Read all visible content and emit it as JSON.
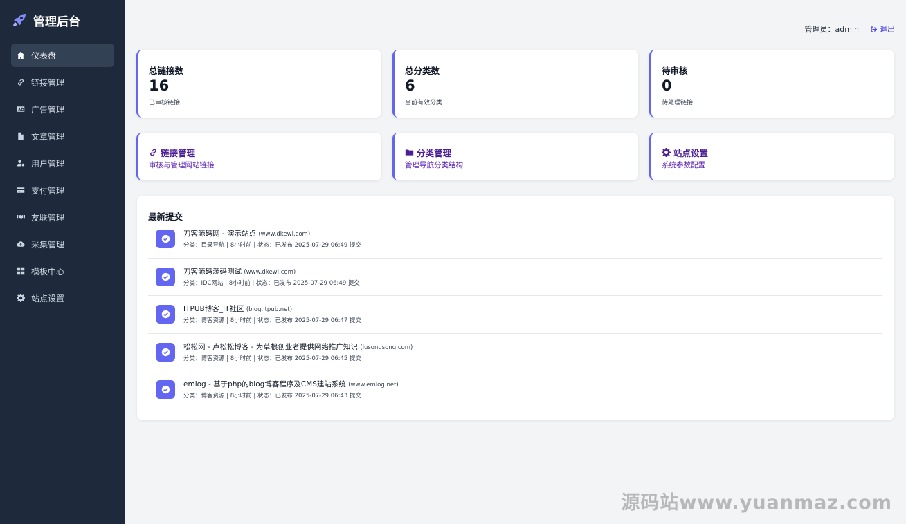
{
  "brand": {
    "title": "管理后台",
    "icon": "rocket-icon"
  },
  "sidebar": {
    "items": [
      {
        "label": "仪表盘",
        "icon": "home-icon",
        "active": true
      },
      {
        "label": "链接管理",
        "icon": "link-icon"
      },
      {
        "label": "广告管理",
        "icon": "ad-icon"
      },
      {
        "label": "文章管理",
        "icon": "file-icon"
      },
      {
        "label": "用户管理",
        "icon": "user-cog-icon"
      },
      {
        "label": "支付管理",
        "icon": "credit-card-icon"
      },
      {
        "label": "友联管理",
        "icon": "handshake-icon"
      },
      {
        "label": "采集管理",
        "icon": "cloud-download-icon"
      },
      {
        "label": "模板中心",
        "icon": "grid-icon"
      },
      {
        "label": "站点设置",
        "icon": "gear-icon"
      }
    ]
  },
  "topbar": {
    "admin_label": "管理员：admin",
    "logout_label": "退出",
    "logout_icon": "sign-out-icon"
  },
  "stats": [
    {
      "title": "总链接数",
      "value": "16",
      "sub": "已审核链接"
    },
    {
      "title": "总分类数",
      "value": "6",
      "sub": "当前有效分类"
    },
    {
      "title": "待审核",
      "value": "0",
      "sub": "待处理链接"
    }
  ],
  "quick_links": [
    {
      "title": "链接管理",
      "sub": "审核与管理网站链接",
      "icon": "link-icon"
    },
    {
      "title": "分类管理",
      "sub": "管理导航分类结构",
      "icon": "folder-icon"
    },
    {
      "title": "站点设置",
      "sub": "系统参数配置",
      "icon": "gear-icon"
    }
  ],
  "submissions": {
    "title": "最新提交",
    "items": [
      {
        "title": "刀客源码网 - 演示站点",
        "domain": "(www.dkewl.com)",
        "meta": "分类：目录导航 | 8小时前 | 状态：已发布 2025-07-29 06:49 提交"
      },
      {
        "title": "刀客源码源码测试",
        "domain": "(www.dkewl.com)",
        "meta": "分类：IDC网站 | 8小时前 | 状态：已发布 2025-07-29 06:49 提交"
      },
      {
        "title": "ITPUB博客_IT社区",
        "domain": "(blog.itpub.net)",
        "meta": "分类：博客资源 | 8小时前 | 状态：已发布 2025-07-29 06:47 提交"
      },
      {
        "title": "松松网 - 卢松松博客 - 为草根创业者提供网络推广知识",
        "domain": "(lusongsong.com)",
        "meta": "分类：博客资源 | 8小时前 | 状态：已发布 2025-07-29 06:45 提交"
      },
      {
        "title": "emlog - 基于php的blog博客程序及CMS建站系统",
        "domain": "(www.emlog.net)",
        "meta": "分类：博客资源 | 8小时前 | 状态：已发布 2025-07-29 06:43 提交"
      }
    ]
  },
  "watermark": "源码站www.yuanmaz.com",
  "colors": {
    "sidebar_bg": "#1e293b",
    "accent": "#6366f1",
    "quick_text": "#4c1d95",
    "page_bg": "#f3f4f6"
  }
}
